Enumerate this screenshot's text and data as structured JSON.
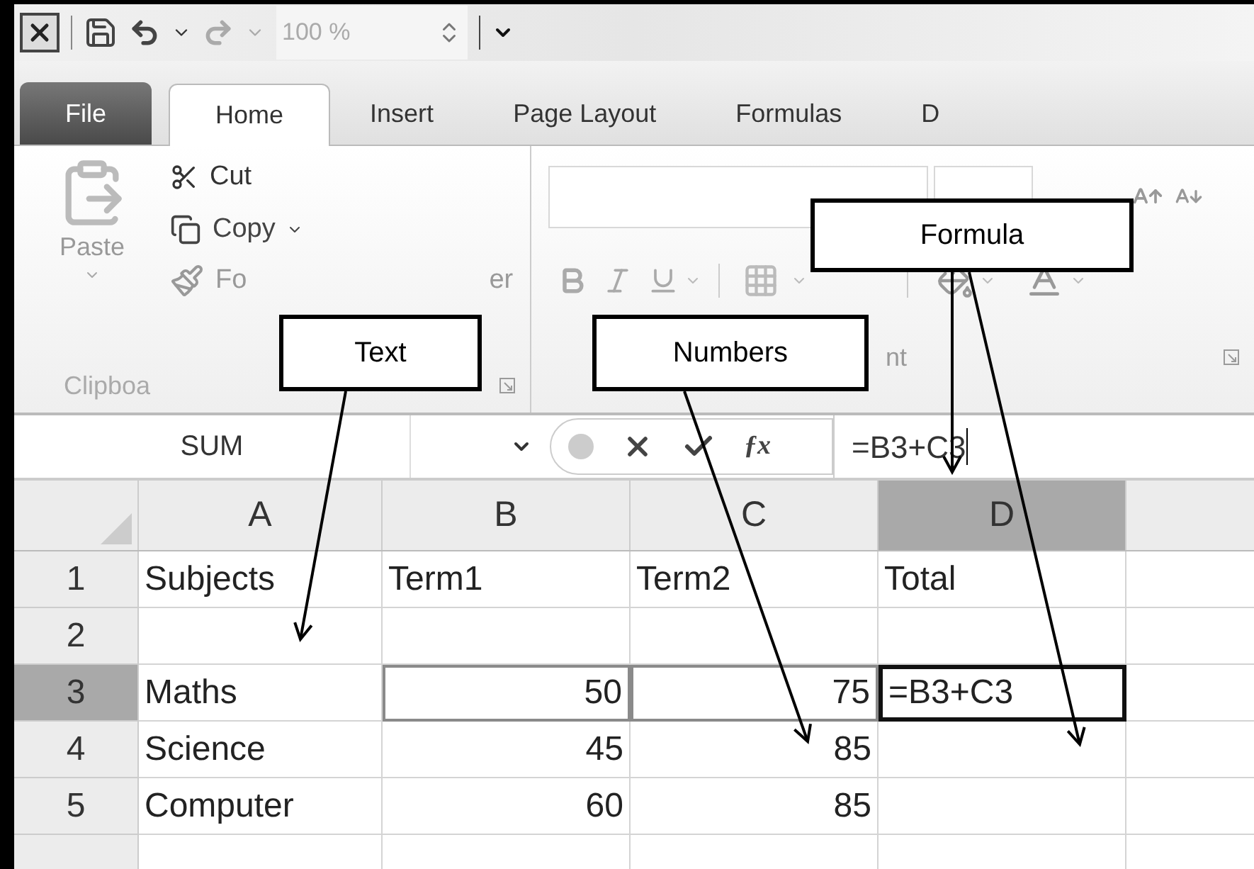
{
  "quick_access": {
    "zoom": "100 %"
  },
  "tabs": [
    {
      "label": "File",
      "kind": "file",
      "selected": false
    },
    {
      "label": "Home",
      "kind": "tab",
      "selected": true
    },
    {
      "label": "Insert",
      "kind": "tab",
      "selected": false
    },
    {
      "label": "Page Layout",
      "kind": "tab",
      "selected": false
    },
    {
      "label": "Formulas",
      "kind": "tab",
      "selected": false
    },
    {
      "label": "D",
      "kind": "tab",
      "selected": false
    }
  ],
  "ribbon": {
    "clipboard": {
      "paste": "Paste",
      "cut": "Cut",
      "copy": "Copy",
      "format_painter_parts": [
        "Fo",
        "er"
      ],
      "group_label": "Clipboa"
    },
    "font": {
      "group_label": "nt"
    }
  },
  "formula_bar": {
    "name_box": "SUM",
    "function_button": "ƒx",
    "formula": "=B3+C3"
  },
  "columns": [
    {
      "label": "A",
      "selected": false
    },
    {
      "label": "B",
      "selected": false
    },
    {
      "label": "C",
      "selected": false
    },
    {
      "label": "D",
      "selected": true
    }
  ],
  "rows": [
    {
      "number": "1",
      "selected": false,
      "cells": [
        {
          "value": "Subjects",
          "kind": "text",
          "selected": false,
          "referenced": false
        },
        {
          "value": "Term1",
          "kind": "text",
          "selected": false,
          "referenced": false
        },
        {
          "value": "Term2",
          "kind": "text",
          "selected": false,
          "referenced": false
        },
        {
          "value": "Total",
          "kind": "text",
          "selected": false,
          "referenced": false
        }
      ]
    },
    {
      "number": "2",
      "selected": false,
      "cells": [
        {
          "selected": false,
          "referenced": false
        },
        {
          "selected": false,
          "referenced": false
        },
        {
          "selected": false,
          "referenced": false
        },
        {
          "selected": false,
          "referenced": false
        }
      ]
    },
    {
      "number": "3",
      "selected": true,
      "cells": [
        {
          "value": "Maths",
          "kind": "text",
          "selected": false,
          "referenced": false
        },
        {
          "value": "50",
          "kind": "number",
          "selected": false,
          "referenced": true
        },
        {
          "value": "75",
          "kind": "number",
          "selected": false,
          "referenced": true
        },
        {
          "value": "=B3+C3",
          "kind": "text",
          "selected": true,
          "referenced": false
        }
      ]
    },
    {
      "number": "4",
      "selected": false,
      "cells": [
        {
          "value": "Science",
          "kind": "text",
          "selected": false,
          "referenced": false
        },
        {
          "value": "45",
          "kind": "number",
          "selected": false,
          "referenced": false
        },
        {
          "value": "85",
          "kind": "number",
          "selected": false,
          "referenced": false
        },
        {
          "selected": false,
          "referenced": false
        }
      ]
    },
    {
      "number": "5",
      "selected": false,
      "cells": [
        {
          "value": "Computer",
          "kind": "text",
          "selected": false,
          "referenced": false
        },
        {
          "value": "60",
          "kind": "number",
          "selected": false,
          "referenced": false
        },
        {
          "value": "85",
          "kind": "number",
          "selected": false,
          "referenced": false
        },
        {
          "selected": false,
          "referenced": false
        }
      ]
    }
  ],
  "callouts": [
    {
      "label": "Text"
    },
    {
      "label": "Numbers"
    },
    {
      "label": "Formula"
    }
  ]
}
